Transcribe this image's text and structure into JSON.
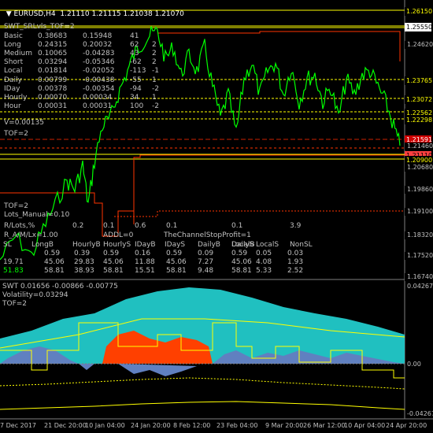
{
  "symbol_header": "EURUSD,H4  1.21110 1.21115 1.21038 1.21070",
  "indicator_title": "SWT_SRLvls_TOF=2",
  "stats_rows": [
    {
      "name": "Basic",
      "a": "0.38683",
      "b": "0.15948",
      "c": "41"
    },
    {
      "name": "Long",
      "a": "0.24315",
      "b": "0.20032",
      "c": "62"
    },
    {
      "name": "Medium",
      "a": "0.10065",
      "b": "-0.04283",
      "c": "43"
    },
    {
      "name": "Short",
      "a": "0.03294",
      "b": "-0.05346",
      "c": "-62"
    },
    {
      "name": "Local",
      "a": "0.01814",
      "b": "-0.02052",
      "c": "-113"
    },
    {
      "name": "Daily",
      "a": "0.00799",
      "b": "-0.00438",
      "c": "-55"
    },
    {
      "name": "IDay",
      "a": "0.00378",
      "b": "-0.00354",
      "c": "-94"
    },
    {
      "name": "Hourly",
      "a": "0.00070",
      "b": "0.00034",
      "c": "34"
    },
    {
      "name": "Hour",
      "a": "0.00031",
      "b": "0.00031",
      "c": "100"
    }
  ],
  "stats_extra": [
    "2",
    "2",
    "2",
    "-1",
    "1",
    "-2",
    "1",
    "-2"
  ],
  "v_line": "V=0.00135",
  "tof_main": "TOF=2",
  "tof_lower": "TOF=2",
  "lots_manual": "Lots_Manual=0.10",
  "risk_row": {
    "label": "R/Lots,%",
    "v1": "0.2",
    "v2": "0.1",
    "v3": "0.6",
    "v4": "0.1",
    "v5": "0.1",
    "v6": "3.9"
  },
  "addl_row": {
    "label": "R_A/M/Lx=1.00",
    "addl": "ADDL=0",
    "profit": "TheChannelStopProfit=1"
  },
  "table_headers": [
    "SL",
    "LongB",
    "HourlyB",
    "HourlyS",
    "IDayB",
    "IDayS",
    "DailyB",
    "DailyS",
    "LocalB",
    "LocalS",
    "NonSL"
  ],
  "table_row1": [
    "",
    "0.59",
    "0.39",
    "0.59",
    "0.16",
    "0.59",
    "0.09",
    "0.59",
    "0.05",
    "0.03"
  ],
  "table_row2": [
    "19.71",
    "45.06",
    "29.83",
    "45.06",
    "11.88",
    "45.06",
    "7.27",
    "45.06",
    "4.08",
    "1.93"
  ],
  "table_row3": [
    "51.83",
    "58.81",
    "38.93",
    "58.81",
    "15.51",
    "58.81",
    "9.48",
    "58.81",
    "5.33",
    "2.52"
  ],
  "price_labels": [
    {
      "value": "1.26150",
      "color": "#ffff00",
      "bg": "#000000",
      "boxed": true
    },
    {
      "value": "1.25550",
      "color": "#000000",
      "bg": "#ffffff",
      "boxed": true
    },
    {
      "value": "1.24620",
      "color": "#c0c0c0",
      "bg": "#000000",
      "boxed": false
    },
    {
      "value": "1.23765",
      "color": "#ffff00",
      "bg": "#000000",
      "boxed": true
    },
    {
      "value": "1.23072",
      "color": "#ffff00",
      "bg": "#000000",
      "boxed": true
    },
    {
      "value": "1.22562",
      "color": "#ffff00",
      "bg": "#000000",
      "boxed": true
    },
    {
      "value": "1.22298",
      "color": "#ffff00",
      "bg": "#000000",
      "boxed": true
    },
    {
      "value": "1.21591",
      "color": "#ffffff",
      "bg": "#cc0000",
      "boxed": true
    },
    {
      "value": "1.21460",
      "color": "#c0c0c0",
      "bg": "#000000",
      "boxed": false
    },
    {
      "value": "1.21110",
      "color": "#000000",
      "bg": "#ff4040",
      "boxed": true
    },
    {
      "value": "1.20900",
      "color": "#ffff00",
      "bg": "#000000",
      "boxed": true
    },
    {
      "value": "1.20680",
      "color": "#c0c0c0",
      "bg": "#000000",
      "boxed": false
    },
    {
      "value": "1.19860",
      "color": "#c0c0c0",
      "bg": "#000000",
      "boxed": false
    },
    {
      "value": "1.19100",
      "color": "#c0c0c0",
      "bg": "#000000",
      "boxed": false
    },
    {
      "value": "1.18320",
      "color": "#c0c0c0",
      "bg": "#000000",
      "boxed": false
    },
    {
      "value": "1.17520",
      "color": "#c0c0c0",
      "bg": "#000000",
      "boxed": false
    },
    {
      "value": "1.16740",
      "color": "#c0c0c0",
      "bg": "#000000",
      "boxed": false
    }
  ],
  "lower_header": "SWT 0.01656 -0.00866 -0.00775",
  "volatility": "Volatility=0.03294",
  "lower_axis": [
    "0.04267",
    "0.00",
    "-0.04267"
  ],
  "time_labels": [
    "7 Dec 2017",
    "21 Dec 20:00",
    "10 Jan 04:00",
    "24 Jan 20:00",
    "8 Feb 12:00",
    "23 Feb 04:00",
    "9 Mar 20:00",
    "26 Mar 12:00",
    "10 Apr 04:00",
    "24 Apr 20:00"
  ],
  "colors": {
    "candle": "#00ff00",
    "level": "#ffff00",
    "stop": "#ff3300",
    "cloud": "#20c0c0",
    "fill_red": "#ff4000",
    "fill_blue": "#6080c0"
  }
}
